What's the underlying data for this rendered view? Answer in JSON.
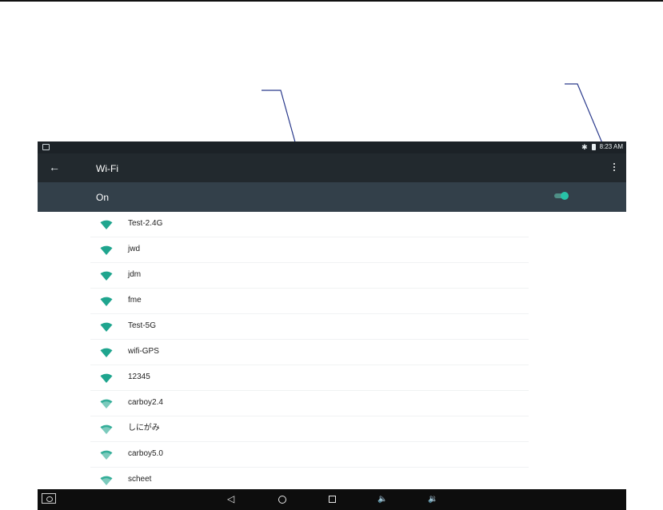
{
  "status_bar": {
    "time": "8:23 AM",
    "icons": [
      "notification-icon",
      "bluetooth-icon",
      "battery-icon"
    ]
  },
  "toolbar": {
    "title": "Wi-Fi",
    "back_icon": "arrow-left-icon",
    "menu_icon": "more-vert-icon"
  },
  "wifi_switch": {
    "label": "On",
    "enabled": true,
    "accent_color": "#28c3a8"
  },
  "networks": [
    {
      "ssid": "Test-2.4G",
      "signal": 4
    },
    {
      "ssid": "jwd",
      "signal": 4
    },
    {
      "ssid": "jdm",
      "signal": 4
    },
    {
      "ssid": "fme",
      "signal": 4
    },
    {
      "ssid": "Test-5G",
      "signal": 4
    },
    {
      "ssid": "wifi-GPS",
      "signal": 4
    },
    {
      "ssid": "12345",
      "signal": 4
    },
    {
      "ssid": "carboy2.4",
      "signal": 3
    },
    {
      "ssid": "しにがみ",
      "signal": 3
    },
    {
      "ssid": "carboy5.0",
      "signal": 3
    },
    {
      "ssid": "scheet",
      "signal": 3
    }
  ],
  "nav_bar": {
    "buttons": [
      "screenshot-icon",
      "back-icon",
      "home-icon",
      "recents-icon",
      "volume-down-icon",
      "volume-up-icon"
    ],
    "back_glyph": "◁",
    "vol_down_glyph": "🔈",
    "vol_up_glyph": "🔉"
  },
  "colors": {
    "toolbar": "#22292e",
    "switch_bar": "#33404a",
    "wifi_icon": "#1fa58e",
    "callout_line": "#2a3a8c"
  }
}
